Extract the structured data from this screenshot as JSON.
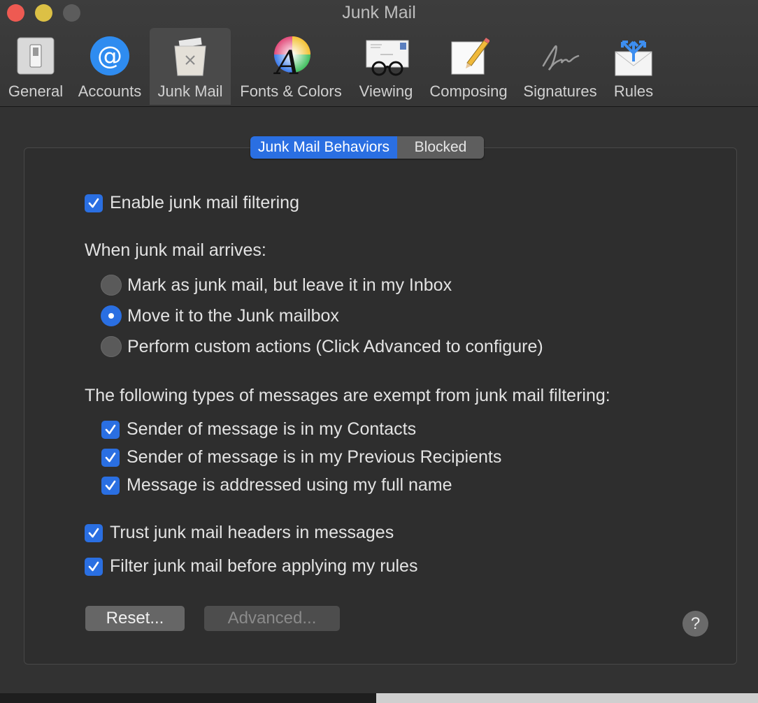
{
  "window": {
    "title": "Junk Mail"
  },
  "toolbar": {
    "items": [
      {
        "label": "General",
        "icon": "general-switch-icon"
      },
      {
        "label": "Accounts",
        "icon": "at-sign-icon"
      },
      {
        "label": "Junk Mail",
        "icon": "trash-can-icon",
        "selected": true
      },
      {
        "label": "Fonts & Colors",
        "icon": "font-color-wheel-icon"
      },
      {
        "label": "Viewing",
        "icon": "envelope-glasses-icon"
      },
      {
        "label": "Composing",
        "icon": "paper-pencil-icon"
      },
      {
        "label": "Signatures",
        "icon": "signature-icon"
      },
      {
        "label": "Rules",
        "icon": "envelope-arrows-icon"
      }
    ]
  },
  "tabs": {
    "behaviors": "Junk Mail Behaviors",
    "blocked": "Blocked",
    "active": "behaviors"
  },
  "settings": {
    "enable_filtering": {
      "label": "Enable junk mail filtering",
      "checked": true
    },
    "arrives_heading": "When junk mail arrives:",
    "arrival_options": [
      {
        "label": "Mark as junk mail, but leave it in my Inbox",
        "selected": false
      },
      {
        "label": "Move it to the Junk mailbox",
        "selected": true
      },
      {
        "label": "Perform custom actions (Click Advanced to configure)",
        "selected": false
      }
    ],
    "exempt_heading": "The following types of messages are exempt from junk mail filtering:",
    "exempt_options": [
      {
        "label": "Sender of message is in my Contacts",
        "checked": true
      },
      {
        "label": "Sender of message is in my Previous Recipients",
        "checked": true
      },
      {
        "label": "Message is addressed using my full name",
        "checked": true
      }
    ],
    "trust_headers": {
      "label": "Trust junk mail headers in messages",
      "checked": true
    },
    "filter_before_rules": {
      "label": "Filter junk mail before applying my rules",
      "checked": true
    }
  },
  "buttons": {
    "reset": "Reset...",
    "advanced": "Advanced...",
    "help": "?"
  },
  "colors": {
    "accent": "#2a6fe2",
    "background": "#323232",
    "titlebar": "#3a3a3a"
  }
}
